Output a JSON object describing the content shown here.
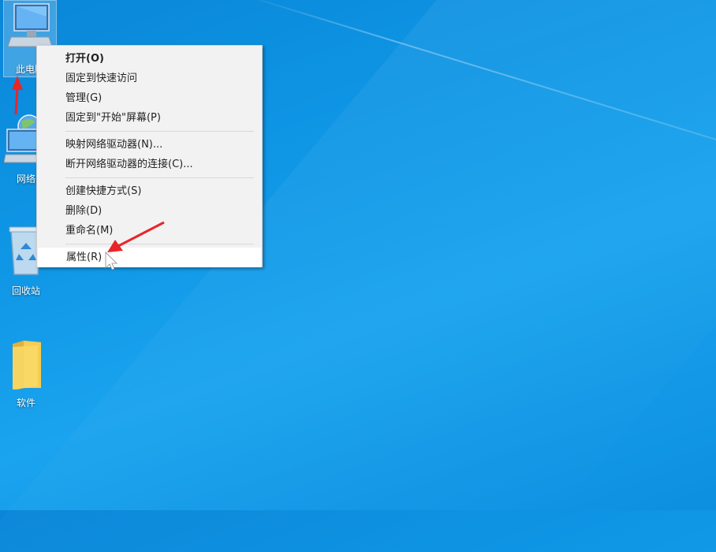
{
  "desktop": {
    "icons": [
      {
        "label": "此电脑",
        "icon": "computer-icon"
      },
      {
        "label": "网络",
        "icon": "network-icon"
      },
      {
        "label": "回收站",
        "icon": "recycle-bin-icon"
      },
      {
        "label": "软件",
        "icon": "folder-icon"
      }
    ]
  },
  "context_menu": {
    "groups": [
      [
        "打开(O)",
        "固定到快速访问",
        "管理(G)",
        "固定到\"开始\"屏幕(P)"
      ],
      [
        "映射网络驱动器(N)...",
        "断开网络驱动器的连接(C)..."
      ],
      [
        "创建快捷方式(S)",
        "删除(D)",
        "重命名(M)"
      ],
      [
        "属性(R)"
      ]
    ]
  },
  "colors": {
    "annotation_arrow": "#e8262a",
    "menu_background": "#f2f2f2",
    "desktop_background": "#0f97e6"
  }
}
